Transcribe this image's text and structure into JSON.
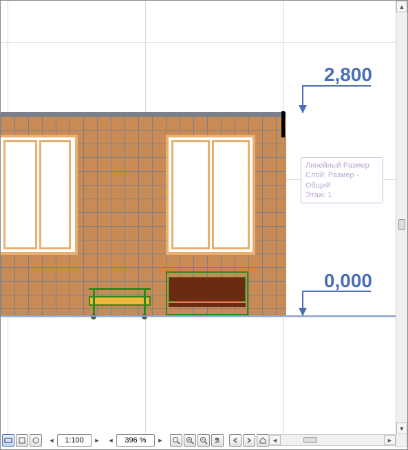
{
  "dimensions": {
    "top": {
      "value": "2,800"
    },
    "bottom": {
      "value": "0,000"
    }
  },
  "tooltip": {
    "title": "Линейный Размер",
    "layer": "Слой: Размер - Общий",
    "floor": "Этаж: 1"
  },
  "statusbar": {
    "scale": "1:100",
    "zoom": "396 %",
    "icons": {
      "view_mode_1": "fit-icon",
      "view_mode_2": "zoom-extents-icon",
      "view_mode_3": "pan-icon",
      "scale_prev": "◄",
      "scale_next": "►",
      "zoom_prev": "◄",
      "zoom_next": "►",
      "zoom_tool": "zoom-icon",
      "zoom_in": "zoom-in-icon",
      "zoom_out": "zoom-out-icon",
      "hand": "hand-icon",
      "prev_view": "prev-view-icon",
      "next_view": "next-view-icon",
      "home": "home-view-icon"
    }
  },
  "scrollbar": {
    "up": "▲",
    "down": "▼",
    "left": "◄",
    "right": "►"
  }
}
